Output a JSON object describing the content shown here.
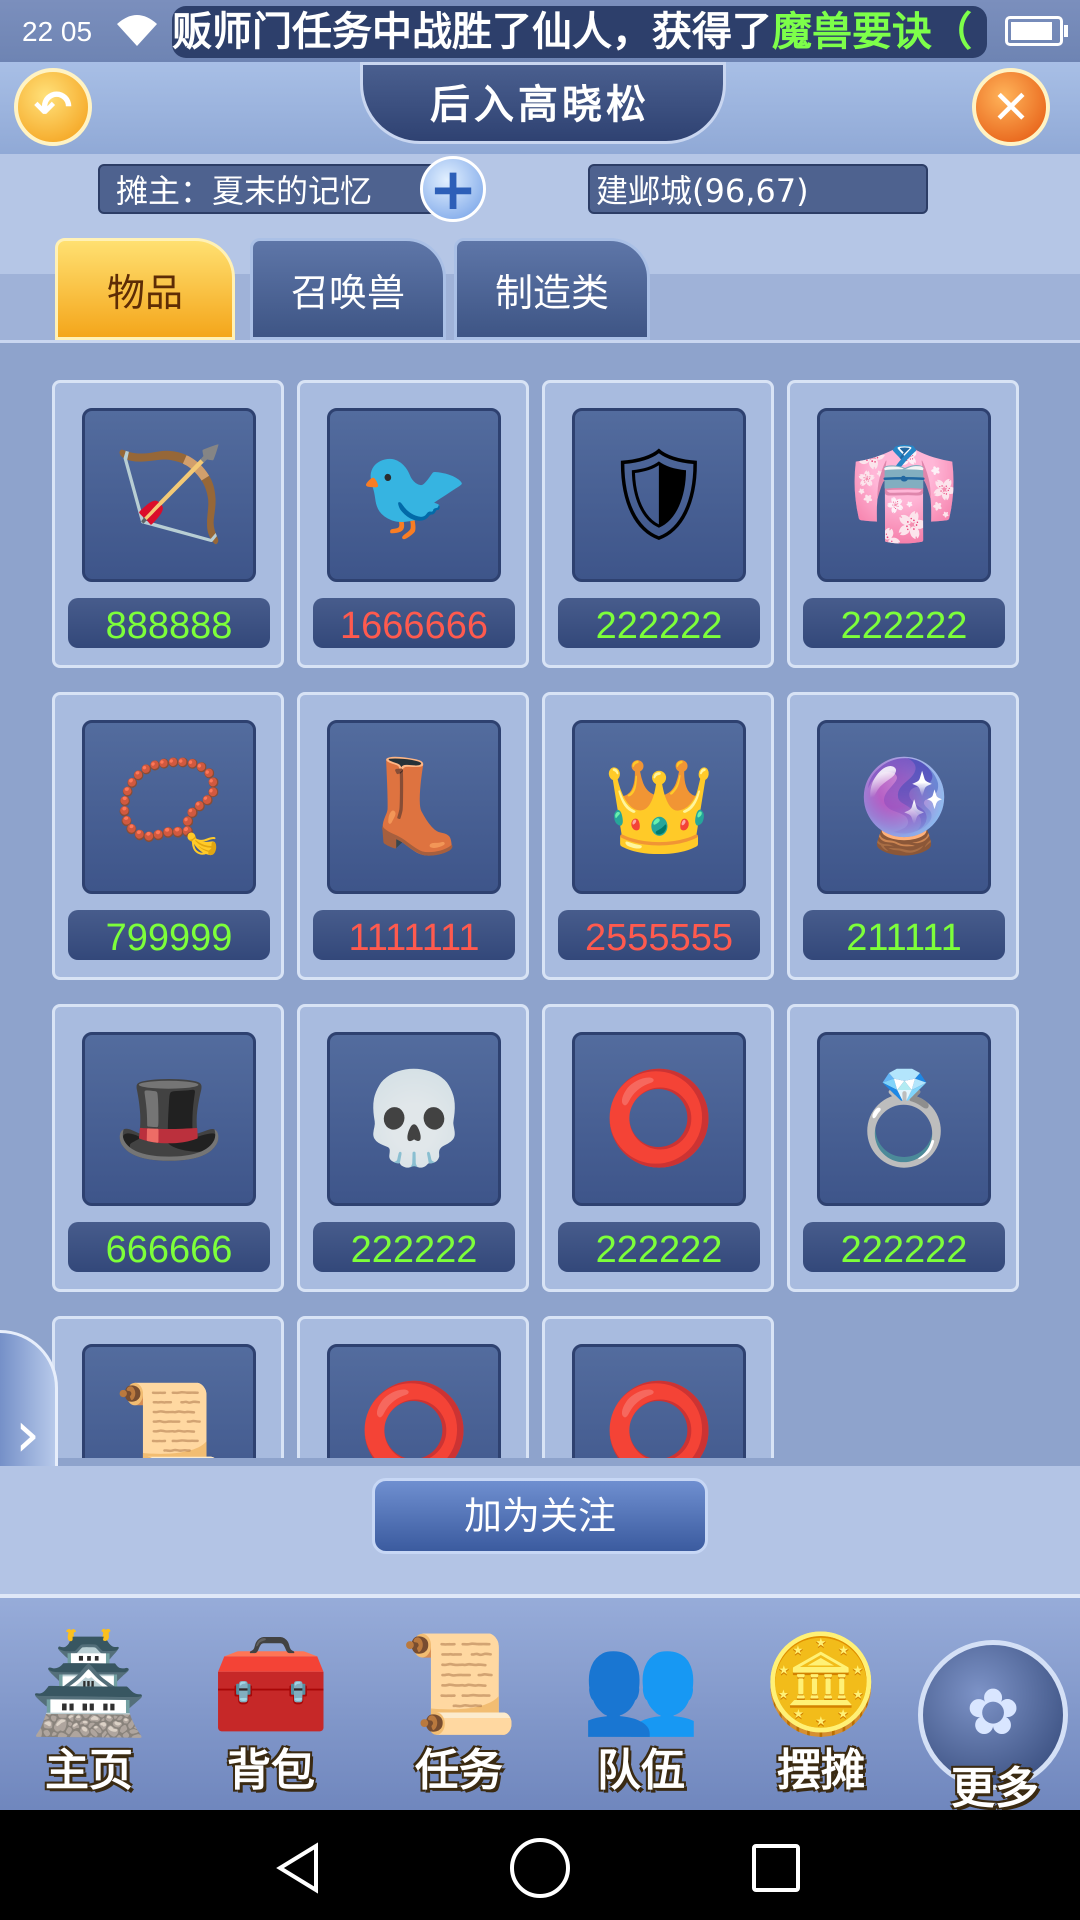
{
  "status_bar": {
    "time": "22 05",
    "marquee_text": "贩师门任务中战胜了仙人，获得了",
    "marquee_highlight": "魔兽要诀（",
    "battery_level": 0.9
  },
  "header": {
    "title": "后入高晓松",
    "back_icon": "back-arrow-icon",
    "close_icon": "close-icon"
  },
  "shop_info": {
    "owner_label": "摊主：夏末的记忆",
    "follow_plus_icon": "plus-icon",
    "location": "建邺城(96,67)"
  },
  "tabs": [
    {
      "label": "物品",
      "active": true
    },
    {
      "label": "召唤兽",
      "active": false
    },
    {
      "label": "制造类",
      "active": false
    }
  ],
  "colors": {
    "price_green": "#7dff3a",
    "price_red": "#ff5a4e"
  },
  "items": [
    {
      "icon": "bow-icon",
      "glyph": "🏹",
      "price": "888888",
      "price_color": "green"
    },
    {
      "icon": "golden-bird-pendant-icon",
      "glyph": "🐦",
      "price": "1666666",
      "price_color": "red"
    },
    {
      "icon": "armor-icon",
      "glyph": "🛡",
      "price": "222222",
      "price_color": "green"
    },
    {
      "icon": "robe-icon",
      "glyph": "👘",
      "price": "222222",
      "price_color": "green"
    },
    {
      "icon": "necklace-armor-icon",
      "glyph": "📿",
      "price": "799999",
      "price_color": "green"
    },
    {
      "icon": "green-boots-icon",
      "glyph": "👢",
      "price": "1111111",
      "price_color": "red"
    },
    {
      "icon": "golden-crown-wings-icon",
      "glyph": "👑",
      "price": "2555555",
      "price_color": "red"
    },
    {
      "icon": "blue-orb-icon",
      "glyph": "🔮",
      "price": "211111",
      "price_color": "green"
    },
    {
      "icon": "striped-hat-icon",
      "glyph": "🎩",
      "price": "666666",
      "price_color": "green"
    },
    {
      "icon": "skull-charm-icon",
      "glyph": "💀",
      "price": "222222",
      "price_color": "green"
    },
    {
      "icon": "ring-icon",
      "glyph": "⭕",
      "price": "222222",
      "price_color": "green"
    },
    {
      "icon": "blue-bracelet-icon",
      "glyph": "💍",
      "price": "222222",
      "price_color": "green"
    },
    {
      "icon": "scroll-bundle-icon",
      "glyph": "📜",
      "price": "",
      "price_color": "green"
    },
    {
      "icon": "golden-ring-icon",
      "glyph": "⭕",
      "price": "",
      "price_color": "green"
    },
    {
      "icon": "gold-hoop-icon",
      "glyph": "⭕",
      "price": "",
      "price_color": "green"
    }
  ],
  "follow_button": "加为关注",
  "nav": [
    {
      "label": "主页",
      "icon": "home-pagoda-icon",
      "glyph": "🏯"
    },
    {
      "label": "背包",
      "icon": "treasure-chest-icon",
      "glyph": "🧰"
    },
    {
      "label": "任务",
      "icon": "quest-scroll-icon",
      "glyph": "📜"
    },
    {
      "label": "队伍",
      "icon": "team-icon",
      "glyph": "👥"
    },
    {
      "label": "摆摊",
      "icon": "stall-coin-icon",
      "glyph": "🪙"
    },
    {
      "label": "更多",
      "icon": "more-icon",
      "glyph": "✿"
    }
  ]
}
